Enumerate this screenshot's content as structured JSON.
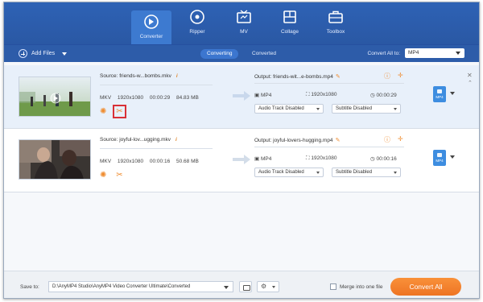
{
  "nav": {
    "items": [
      {
        "label": "Converter",
        "icon": "converter-icon",
        "active": true
      },
      {
        "label": "Ripper",
        "icon": "ripper-icon",
        "active": false
      },
      {
        "label": "MV",
        "icon": "mv-icon",
        "active": false
      },
      {
        "label": "Collage",
        "icon": "collage-icon",
        "active": false
      },
      {
        "label": "Toolbox",
        "icon": "toolbox-icon",
        "active": false
      }
    ]
  },
  "toolbar": {
    "add_files": "Add Files",
    "tab_converting": "Converting",
    "tab_converted": "Converted",
    "convert_all_to_label": "Convert All to:",
    "convert_all_format": "MP4"
  },
  "files": [
    {
      "source": "Source: friends-w...bombs.mkv",
      "container": "MKV",
      "resolution": "1920x1080",
      "duration": "00:00:29",
      "size": "84.83 MB",
      "output": "Output: friends-wit...e-bombs.mp4",
      "out_format": "MP4",
      "out_resolution": "1920x1080",
      "out_duration": "00:00:29",
      "audio": "Audio Track Disabled",
      "subtitle": "Subtitle Disabled",
      "badge": "MP4",
      "selected": true
    },
    {
      "source": "Source: joyful-lov...ugging.mkv",
      "container": "MKV",
      "resolution": "1920x1080",
      "duration": "00:00:16",
      "size": "50.68 MB",
      "output": "Output: joyful-lovers-hugging.mp4",
      "out_format": "MP4",
      "out_resolution": "1920x1080",
      "out_duration": "00:00:16",
      "audio": "Audio Track Disabled",
      "subtitle": "Subtitle Disabled",
      "badge": "MP4",
      "selected": false
    }
  ],
  "bottom": {
    "save_to_label": "Save to:",
    "save_path": "D:\\AnyMP4 Studio\\AnyMP4 Video Converter Ultimate\\Converted",
    "merge_label": "Merge into one file",
    "convert_all_button": "Convert All"
  },
  "colors": {
    "header": "#2a5aa8",
    "accent_orange": "#f5822d",
    "highlight_red": "#d93036"
  }
}
